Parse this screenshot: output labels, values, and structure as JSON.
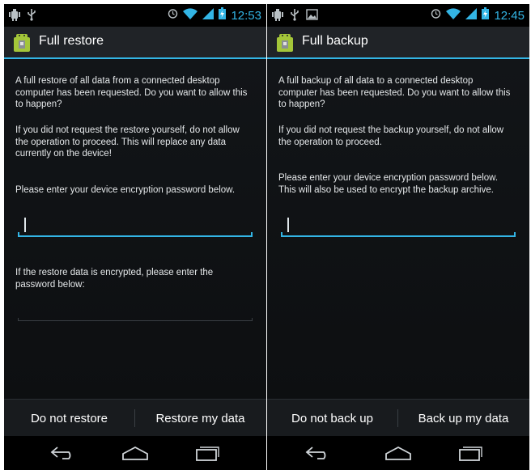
{
  "colors": {
    "accent": "#33b5e5",
    "background": "#0d0f11",
    "action_bar": "#202327",
    "text": "#e5e8ea"
  },
  "left_screen": {
    "status_bar": {
      "time": "12:53",
      "icons_left": [
        "usb-debugging-icon",
        "usb-icon"
      ],
      "icons_right": [
        "alarm-icon",
        "wifi-icon",
        "signal-icon",
        "battery-icon"
      ]
    },
    "title": "Full restore",
    "paragraphs": [
      "A full restore of all data from a connected desktop computer has been requested. Do you want to allow this to happen?",
      "If you did not request the restore yourself, do not allow the operation to proceed. This will replace any data currently on the device!",
      "Please enter your device encryption password below.",
      "If the restore data is encrypted, please enter the password below:"
    ],
    "device_password_value": "",
    "restore_password_value": "",
    "buttons": {
      "deny": "Do not restore",
      "allow": "Restore my data"
    }
  },
  "right_screen": {
    "status_bar": {
      "time": "12:45",
      "icons_left": [
        "usb-debugging-icon",
        "usb-icon",
        "image-icon"
      ],
      "icons_right": [
        "alarm-icon",
        "wifi-icon",
        "signal-icon",
        "battery-icon"
      ]
    },
    "title": "Full backup",
    "paragraphs": [
      "A full backup of all data to a connected desktop computer has been requested. Do you want to allow this to happen?",
      "If you did not request the backup yourself, do not allow the operation to proceed.",
      "Please enter your device encryption password below. This will also be used to encrypt the backup archive."
    ],
    "device_password_value": "",
    "buttons": {
      "deny": "Do not back up",
      "allow": "Back up my data"
    }
  },
  "nav_bar": {
    "icons": [
      "back-icon",
      "home-icon",
      "recent-apps-icon"
    ]
  }
}
